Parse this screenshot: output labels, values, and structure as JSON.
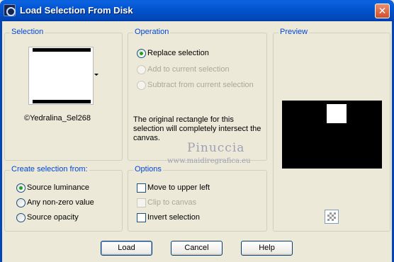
{
  "window": {
    "title": "Load Selection From Disk",
    "close_glyph": "✕"
  },
  "selection_group": {
    "title": "Selection",
    "file_name": "©Yedralina_Sel268"
  },
  "operation_group": {
    "title": "Operation",
    "options": [
      {
        "label": "Replace selection",
        "checked": true,
        "enabled": true
      },
      {
        "label": "Add to current selection",
        "checked": false,
        "enabled": false
      },
      {
        "label": "Subtract from current selection",
        "checked": false,
        "enabled": false
      }
    ],
    "description": "The original rectangle for this selection will completely intersect the canvas."
  },
  "preview_group": {
    "title": "Preview"
  },
  "create_group": {
    "title": "Create selection from:",
    "options": [
      {
        "label": "Source luminance",
        "checked": true
      },
      {
        "label": "Any non-zero value",
        "checked": false
      },
      {
        "label": "Source opacity",
        "checked": false
      }
    ]
  },
  "options_group": {
    "title": "Options",
    "items": [
      {
        "label": "Move to upper left",
        "checked": false,
        "enabled": true
      },
      {
        "label": "Clip to canvas",
        "checked": false,
        "enabled": false
      },
      {
        "label": "Invert selection",
        "checked": false,
        "enabled": true
      }
    ]
  },
  "watermark": {
    "name": "Pinuccia",
    "url": "www.maidiregrafica.eu"
  },
  "buttons": {
    "load": "Load",
    "cancel": "Cancel",
    "help": "Help"
  },
  "colors": {
    "titlebar": "#0355d0",
    "group_title": "#0046d5",
    "dialog_bg": "#ece9d8"
  }
}
